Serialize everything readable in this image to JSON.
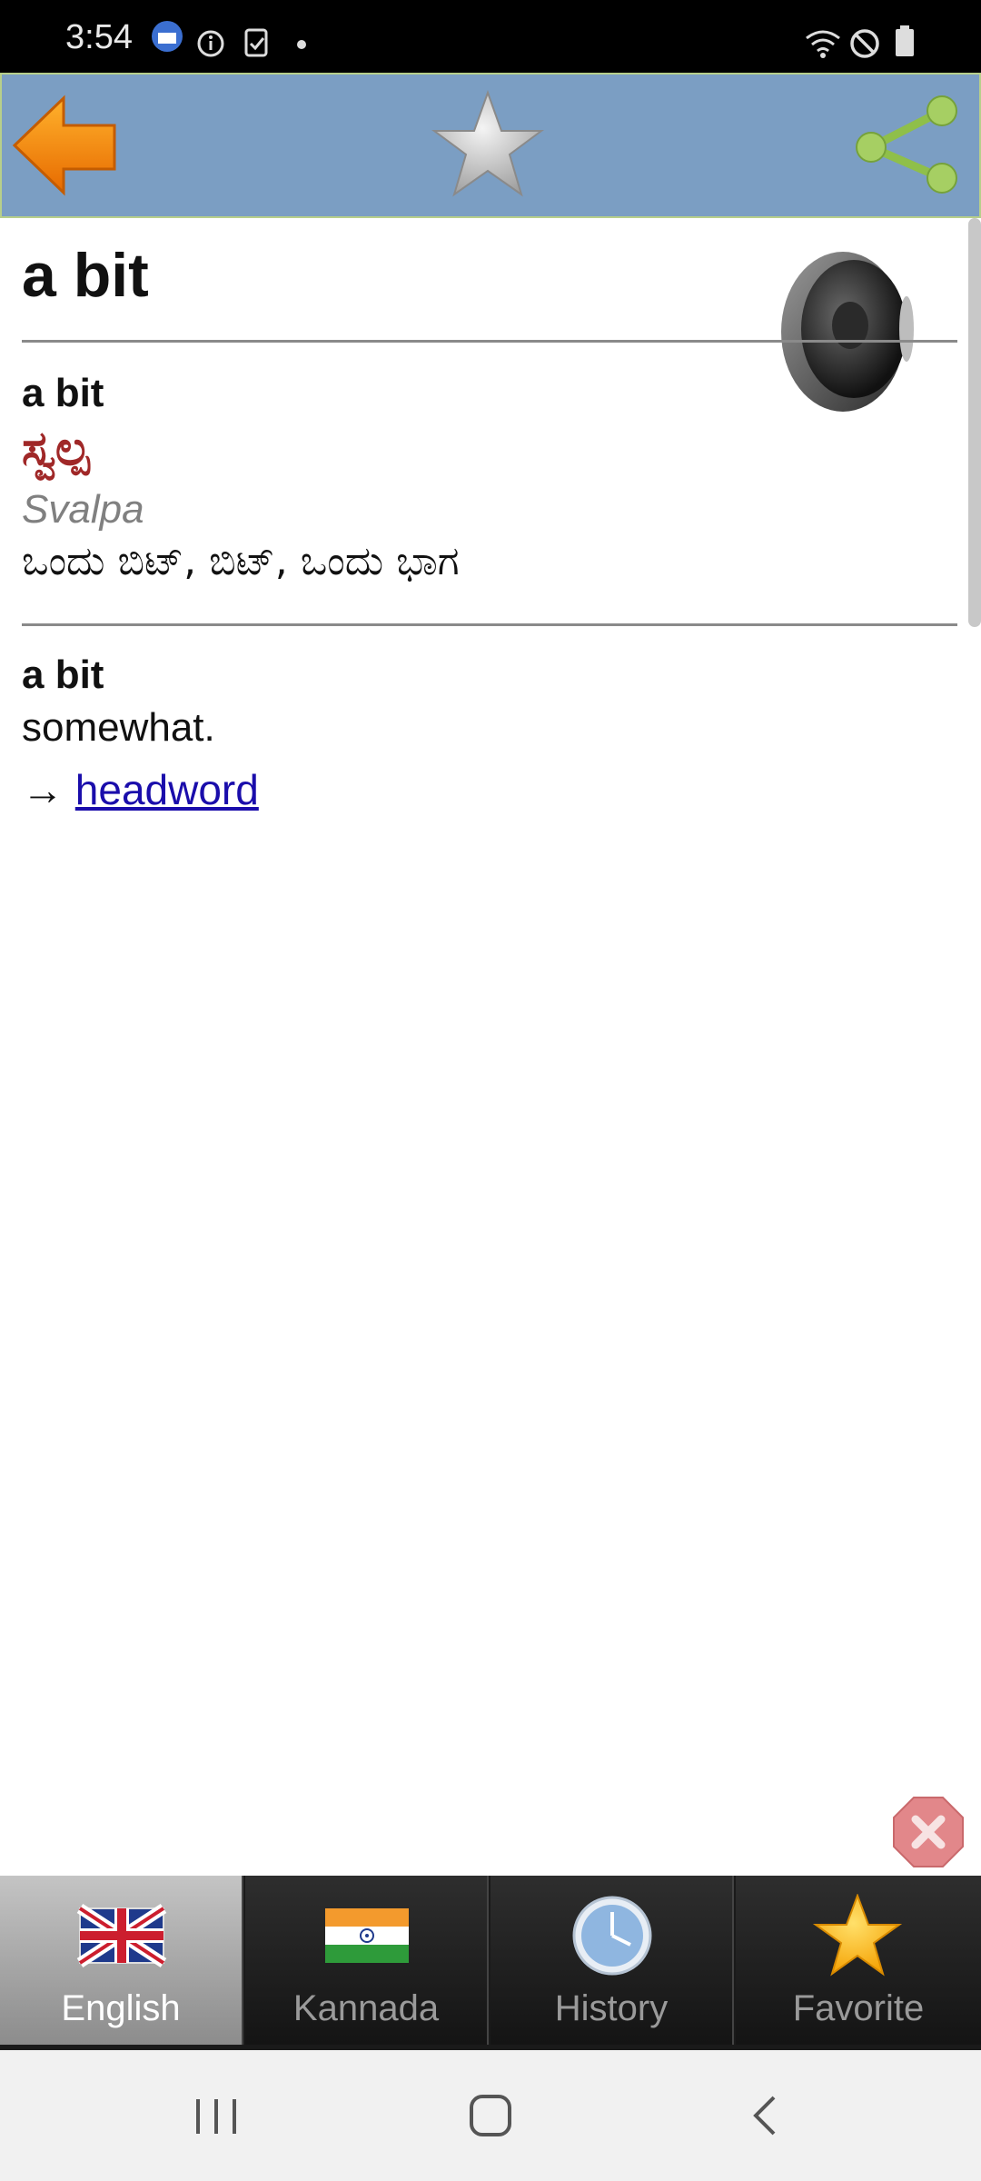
{
  "status_bar": {
    "time": "3:54"
  },
  "headword": "a bit",
  "entries": [
    {
      "word": "a bit",
      "translation": "ಸ್ವಲ್ಪ",
      "transliteration": "Svalpa",
      "synonyms": "ಒಂದು ಬಿಟ್, ಬಿಟ್, ಒಂದು ಭಾಗ"
    },
    {
      "word": "a bit",
      "definition": "somewhat.",
      "arrow": "→",
      "link_text": "headword"
    }
  ],
  "tabs": [
    {
      "label": "English",
      "icon": "uk-flag-icon",
      "active": true
    },
    {
      "label": "Kannada",
      "icon": "india-flag-icon",
      "active": false
    },
    {
      "label": "History",
      "icon": "clock-icon",
      "active": false
    },
    {
      "label": "Favorite",
      "icon": "star-icon",
      "active": false
    }
  ],
  "colors": {
    "toolbar": "#7b9ec3",
    "translation": "#a02828",
    "link": "#1a0dab",
    "back_arrow": "#f08a10",
    "share": "#8fbf4a"
  }
}
